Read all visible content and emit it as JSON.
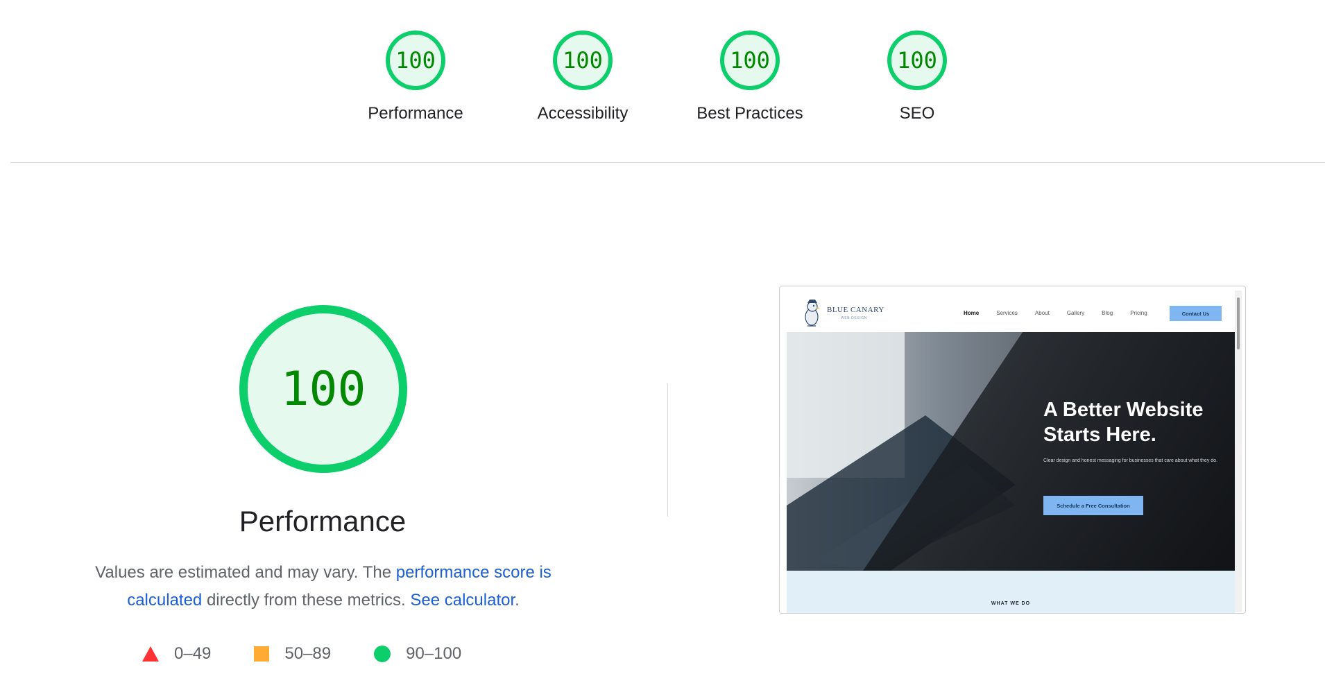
{
  "categories": [
    {
      "label": "Performance",
      "score": "100"
    },
    {
      "label": "Accessibility",
      "score": "100"
    },
    {
      "label": "Best Practices",
      "score": "100"
    },
    {
      "label": "SEO",
      "score": "100"
    }
  ],
  "performance": {
    "score": "100",
    "title": "Performance",
    "desc_text_1": "Values are estimated and may vary. The ",
    "desc_link_1": "performance score is calculated",
    "desc_text_2": " directly from these metrics. ",
    "desc_link_2": "See calculator",
    "desc_text_3": "."
  },
  "legend": [
    {
      "range": "0–49",
      "shape": "triangle",
      "color": "#ff3333"
    },
    {
      "range": "50–89",
      "shape": "square",
      "color": "#ffaa33"
    },
    {
      "range": "90–100",
      "shape": "circle",
      "color": "#0cce6b"
    }
  ],
  "screenshot": {
    "logo_text": "BLUE CANARY",
    "logo_sub": "WEB DESIGN",
    "nav": [
      "Home",
      "Services",
      "About",
      "Gallery",
      "Blog",
      "Pricing"
    ],
    "contact_label": "Contact Us",
    "hero_line1": "A Better Website",
    "hero_line2": "Starts Here.",
    "hero_sub": "Clear design and honest messaging for businesses that care about what they do.",
    "hero_cta": "Schedule a Free Consultation",
    "section_label": "WHAT WE DO"
  },
  "colors": {
    "pass": "#0cce6b",
    "pass_text": "#008800",
    "link": "#1a5fd6"
  }
}
